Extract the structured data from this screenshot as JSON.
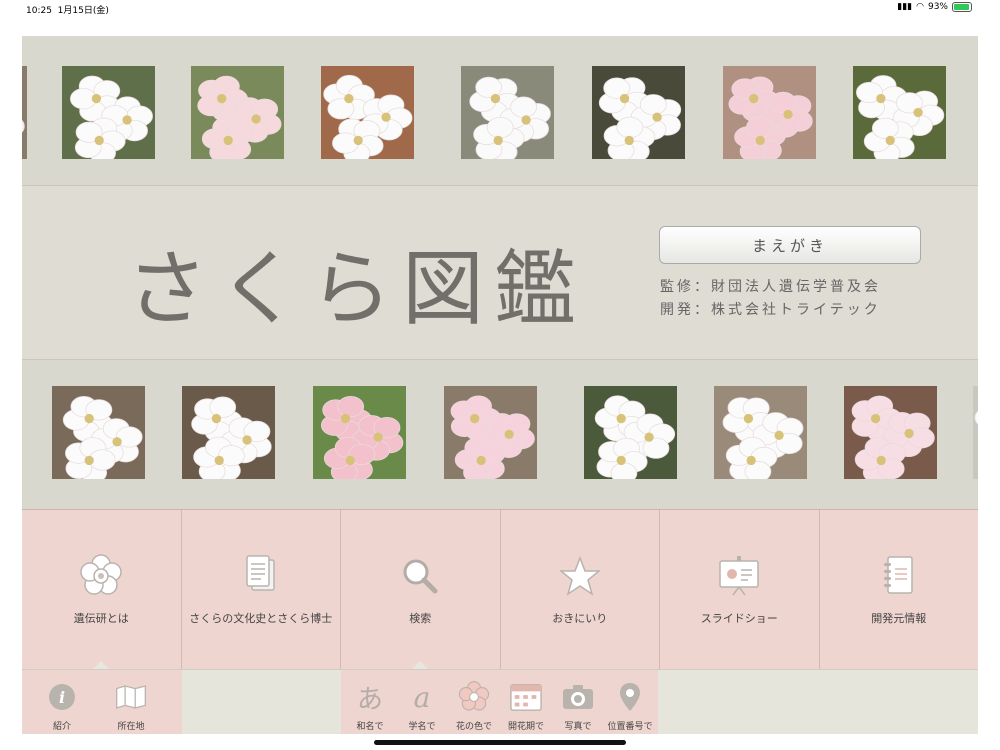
{
  "status": {
    "time": "10:25",
    "date": "1月15日(金)",
    "battery": "93%",
    "battery_level": 0.93
  },
  "app": {
    "title": "さくら図鑑",
    "preface_button": "まえがき",
    "supervision": "監修：財団法人遺伝学普及会",
    "development": "開発：株式会社トライテック"
  },
  "menu": {
    "items": [
      {
        "label": "遺伝研とは",
        "icon": "flower-icon"
      },
      {
        "label": "さくらの文化史とさくら博士",
        "icon": "document-icon"
      },
      {
        "label": "検索",
        "icon": "search-icon"
      },
      {
        "label": "おきにいり",
        "icon": "star-icon"
      },
      {
        "label": "スライドショー",
        "icon": "slideshow-icon"
      },
      {
        "label": "開発元情報",
        "icon": "notebook-icon"
      }
    ]
  },
  "submenu": {
    "about": [
      {
        "label": "紹介",
        "icon": "info-icon"
      },
      {
        "label": "所在地",
        "icon": "map-icon"
      }
    ],
    "search": [
      {
        "label": "和名で",
        "icon": "hiragana-a-icon",
        "glyph": "あ"
      },
      {
        "label": "学名で",
        "icon": "latin-a-icon",
        "glyph": "a"
      },
      {
        "label": "花の色で",
        "icon": "flower-color-icon"
      },
      {
        "label": "開花期で",
        "icon": "calendar-icon"
      },
      {
        "label": "写真で",
        "icon": "camera-icon"
      },
      {
        "label": "位置番号で",
        "icon": "location-pin-icon"
      }
    ]
  },
  "colors": {
    "menu_bg": "#efd5cf",
    "band_bg": "#dedcd3",
    "title": "#716f69"
  }
}
